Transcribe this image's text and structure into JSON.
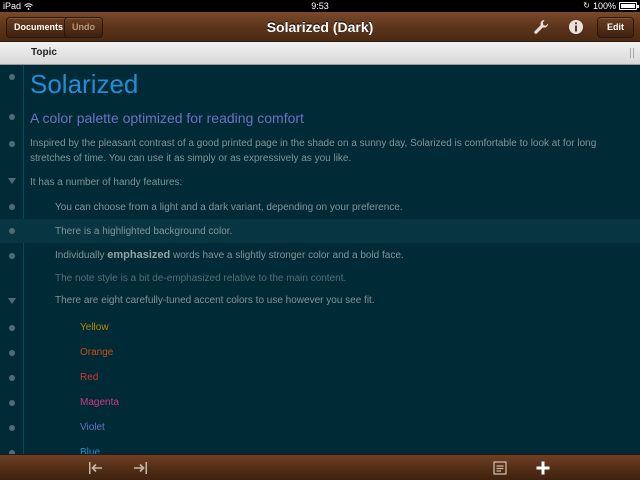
{
  "status_bar": {
    "device": "iPad",
    "time": "9:53",
    "battery": "100%"
  },
  "navbar": {
    "documents_label": "Documents",
    "undo_label": "Undo",
    "title": "Solarized (Dark)",
    "edit_label": "Edit"
  },
  "column_header": {
    "label": "Topic"
  },
  "outline": {
    "title": "Solarized",
    "subtitle": "A color palette optimized for reading comfort",
    "intro": "Inspired by the pleasant contrast of a good printed page in the shade on a sunny day, Solarized is comfortable to look at for long stretches of time. You can use it as simply or as expressively as you like.",
    "features_heading": "It has a number of handy features:",
    "feature_variants": "You can choose from a light and a dark variant, depending on your preference.",
    "feature_highlight": "There is a highlighted background color.",
    "emph_prefix": "Individually",
    "emph_word": "emphasized",
    "emph_suffix": "words have a slightly stronger color and a bold face.",
    "note_line": "The note style is a bit de-emphasized relative to the main content.",
    "accents_heading": "There are eight carefully-tuned accent colors to use however you see fit.",
    "accents": [
      {
        "name": "Yellow",
        "color": "#b58900"
      },
      {
        "name": "Orange",
        "color": "#cb4b16"
      },
      {
        "name": "Red",
        "color": "#dc322f"
      },
      {
        "name": "Magenta",
        "color": "#d33682"
      },
      {
        "name": "Violet",
        "color": "#6c71c4"
      },
      {
        "name": "Blue",
        "color": "#268bd2"
      }
    ]
  },
  "icons": {
    "wrench": "wrench-icon",
    "info": "info-icon",
    "outdent": "outdent-icon",
    "indent": "indent-icon",
    "note": "note-icon",
    "add": "plus-icon"
  },
  "colors": {
    "base03": "#002b36",
    "base02": "#073642",
    "base01": "#586e75",
    "base0": "#839496",
    "base1": "#93a1a1",
    "navbar_wood": "#5a3319"
  }
}
